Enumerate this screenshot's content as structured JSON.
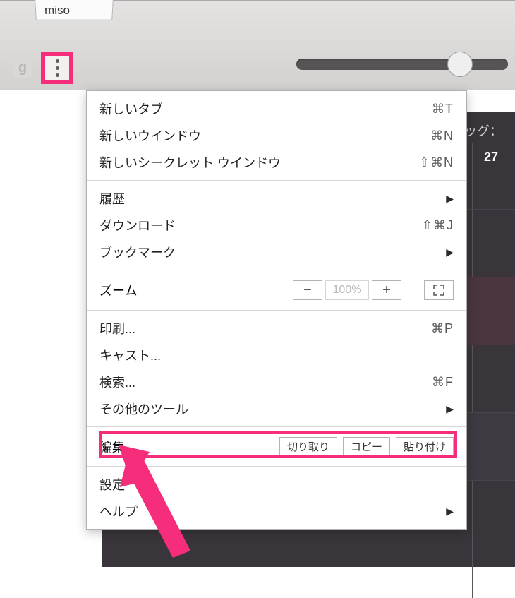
{
  "tab": {
    "title": "miso"
  },
  "darkpanel": {
    "tag_label": "ッグ：",
    "daynum": "27"
  },
  "menu": {
    "new_tab": {
      "label": "新しいタブ",
      "shortcut": "⌘T"
    },
    "new_window": {
      "label": "新しいウインドウ",
      "shortcut": "⌘N"
    },
    "new_incognito": {
      "label": "新しいシークレット ウインドウ",
      "shortcut": "⇧⌘N"
    },
    "history": {
      "label": "履歴"
    },
    "downloads": {
      "label": "ダウンロード",
      "shortcut": "⇧⌘J"
    },
    "bookmarks": {
      "label": "ブックマーク"
    },
    "zoom": {
      "label": "ズーム",
      "value": "100%"
    },
    "print": {
      "label": "印刷...",
      "shortcut": "⌘P"
    },
    "cast": {
      "label": "キャスト..."
    },
    "find": {
      "label": "検索...",
      "shortcut": "⌘F"
    },
    "more_tools": {
      "label": "その他のツール"
    },
    "edit": {
      "label": "編集",
      "cut": "切り取り",
      "copy": "コピー",
      "paste": "貼り付け"
    },
    "settings": {
      "label": "設定"
    },
    "help": {
      "label": "ヘルプ"
    }
  }
}
